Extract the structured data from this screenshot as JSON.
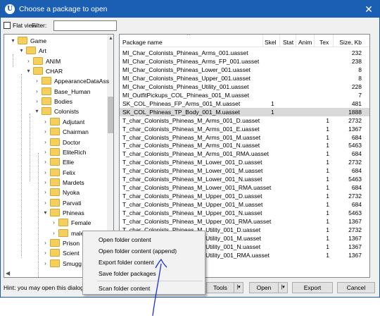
{
  "window": {
    "title": "Choose a package to open",
    "logo": "U"
  },
  "toolbar": {
    "flat_view": "Flat view",
    "filter_label": "Filter:",
    "filter_value": ""
  },
  "tree": [
    {
      "label": "Game",
      "expander": "▾"
    },
    {
      "label": "Art",
      "expander": "▾"
    },
    {
      "label": "ANIM",
      "expander": "›"
    },
    {
      "label": "CHAR",
      "expander": "▾"
    },
    {
      "label": "AppearanceDataAss",
      "expander": "›"
    },
    {
      "label": "Base_Human",
      "expander": "›"
    },
    {
      "label": "Bodies",
      "expander": "›"
    },
    {
      "label": "Colonists",
      "expander": "▾"
    },
    {
      "label": "Adjutant",
      "expander": "›"
    },
    {
      "label": "Chairman",
      "expander": "›"
    },
    {
      "label": "Doctor",
      "expander": "›"
    },
    {
      "label": "EliteRich",
      "expander": "›"
    },
    {
      "label": "Ellie",
      "expander": "›"
    },
    {
      "label": "Felix",
      "expander": "›"
    },
    {
      "label": "Mardets",
      "expander": "›"
    },
    {
      "label": "Nyoka",
      "expander": "›"
    },
    {
      "label": "Parvati",
      "expander": "›"
    },
    {
      "label": "Phineas",
      "expander": "▾"
    },
    {
      "label": "Female",
      "expander": "›"
    },
    {
      "label": "male",
      "expander": "›"
    },
    {
      "label": "Prison",
      "expander": "›"
    },
    {
      "label": "Scient",
      "expander": "›"
    },
    {
      "label": "Smugg",
      "expander": "›"
    }
  ],
  "list": {
    "columns": {
      "name": "Package name",
      "skel": "Skel",
      "stat": "Stat",
      "anim": "Anim",
      "tex": "Tex",
      "size": "Size, Kb"
    },
    "rows": [
      {
        "name": "MI_Char_Colonists_Phineas_Arms_001.uasset",
        "skel": "",
        "tex": "",
        "size": "232"
      },
      {
        "name": "MI_Char_Colonists_Phineas_Arms_FP_001.uasset",
        "skel": "",
        "tex": "",
        "size": "238"
      },
      {
        "name": "MI_Char_Colonists_Phineas_Lower_001.uasset",
        "skel": "",
        "tex": "",
        "size": "8"
      },
      {
        "name": "MI_Char_Colonists_Phineas_Upper_001.uasset",
        "skel": "",
        "tex": "",
        "size": "8"
      },
      {
        "name": "MI_Char_Colonists_Phineas_Utility_001.uasset",
        "skel": "",
        "tex": "",
        "size": "228"
      },
      {
        "name": "MI_OutfitPickups_COL_Phineas_001_M.uasset",
        "skel": "",
        "tex": "",
        "size": "7"
      },
      {
        "name": "SK_COL_Phineas_FP_Arms_001_M.uasset",
        "skel": "1",
        "tex": "",
        "size": "481"
      },
      {
        "name": "SK_COL_Phineas_TP_Body_001_M.uasset",
        "skel": "1",
        "tex": "",
        "size": "1888",
        "selected": true
      },
      {
        "name": "T_char_Colonists_Phineas_M_Arms_001_D.uasset",
        "skel": "",
        "tex": "1",
        "size": "2732"
      },
      {
        "name": "T_char_Colonists_Phineas_M_Arms_001_E.uasset",
        "skel": "",
        "tex": "1",
        "size": "1367"
      },
      {
        "name": "T_char_Colonists_Phineas_M_Arms_001_M.uasset",
        "skel": "",
        "tex": "1",
        "size": "684"
      },
      {
        "name": "T_char_Colonists_Phineas_M_Arms_001_N.uasset",
        "skel": "",
        "tex": "1",
        "size": "5463"
      },
      {
        "name": "T_char_Colonists_Phineas_M_Arms_001_RMA.uasset",
        "skel": "",
        "tex": "1",
        "size": "684"
      },
      {
        "name": "T_char_Colonists_Phineas_M_Lower_001_D.uasset",
        "skel": "",
        "tex": "1",
        "size": "2732"
      },
      {
        "name": "T_char_Colonists_Phineas_M_Lower_001_M.uasset",
        "skel": "",
        "tex": "1",
        "size": "684"
      },
      {
        "name": "T_char_Colonists_Phineas_M_Lower_001_N.uasset",
        "skel": "",
        "tex": "1",
        "size": "5463"
      },
      {
        "name": "T_char_Colonists_Phineas_M_Lower_001_RMA.uasset",
        "skel": "",
        "tex": "1",
        "size": "684"
      },
      {
        "name": "T_char_Colonists_Phineas_M_Upper_001_D.uasset",
        "skel": "",
        "tex": "1",
        "size": "2732"
      },
      {
        "name": "T_char_Colonists_Phineas_M_Upper_001_M.uasset",
        "skel": "",
        "tex": "1",
        "size": "684"
      },
      {
        "name": "T_char_Colonists_Phineas_M_Upper_001_N.uasset",
        "skel": "",
        "tex": "1",
        "size": "5463"
      },
      {
        "name": "T_char_Colonists_Phineas_M_Upper_001_RMA.uasset",
        "skel": "",
        "tex": "1",
        "size": "1367"
      },
      {
        "name": "T_char_Colonists_Phineas_M_Utility_001_D.uasset",
        "skel": "",
        "tex": "1",
        "size": "2732"
      },
      {
        "name": "T_char_Colonists_Phineas_M_Utility_001_M.uasset",
        "skel": "",
        "tex": "1",
        "size": "1367"
      },
      {
        "name": "T_char_Colonists_Phineas_M_Utility_001_N.uasset",
        "skel": "",
        "tex": "1",
        "size": "1367"
      },
      {
        "name": "T_char_Colonists_Phineas_M_Utility_001_RMA.uasset",
        "skel": "",
        "tex": "1",
        "size": "1367"
      }
    ]
  },
  "context_menu": [
    "Open folder content",
    "Open folder content (append)",
    "Export folder content",
    "Save folder packages",
    "Scan folder content"
  ],
  "footer": {
    "hint": "Hint: you may open this dialog a",
    "tools": "Tools",
    "open": "Open",
    "export": "Export",
    "cancel": "Cancel"
  },
  "icons": {
    "logo": "unreal-logo-icon",
    "close": "close-icon",
    "folder": "folder-icon",
    "annotation": "hand-drawn-arrow-annotation-icon"
  },
  "colors": {
    "titlebar": "#1a5fb4",
    "folder": "#f5cf5c",
    "selection": "#d9d9d9",
    "annotation": "#1a2fd6"
  }
}
